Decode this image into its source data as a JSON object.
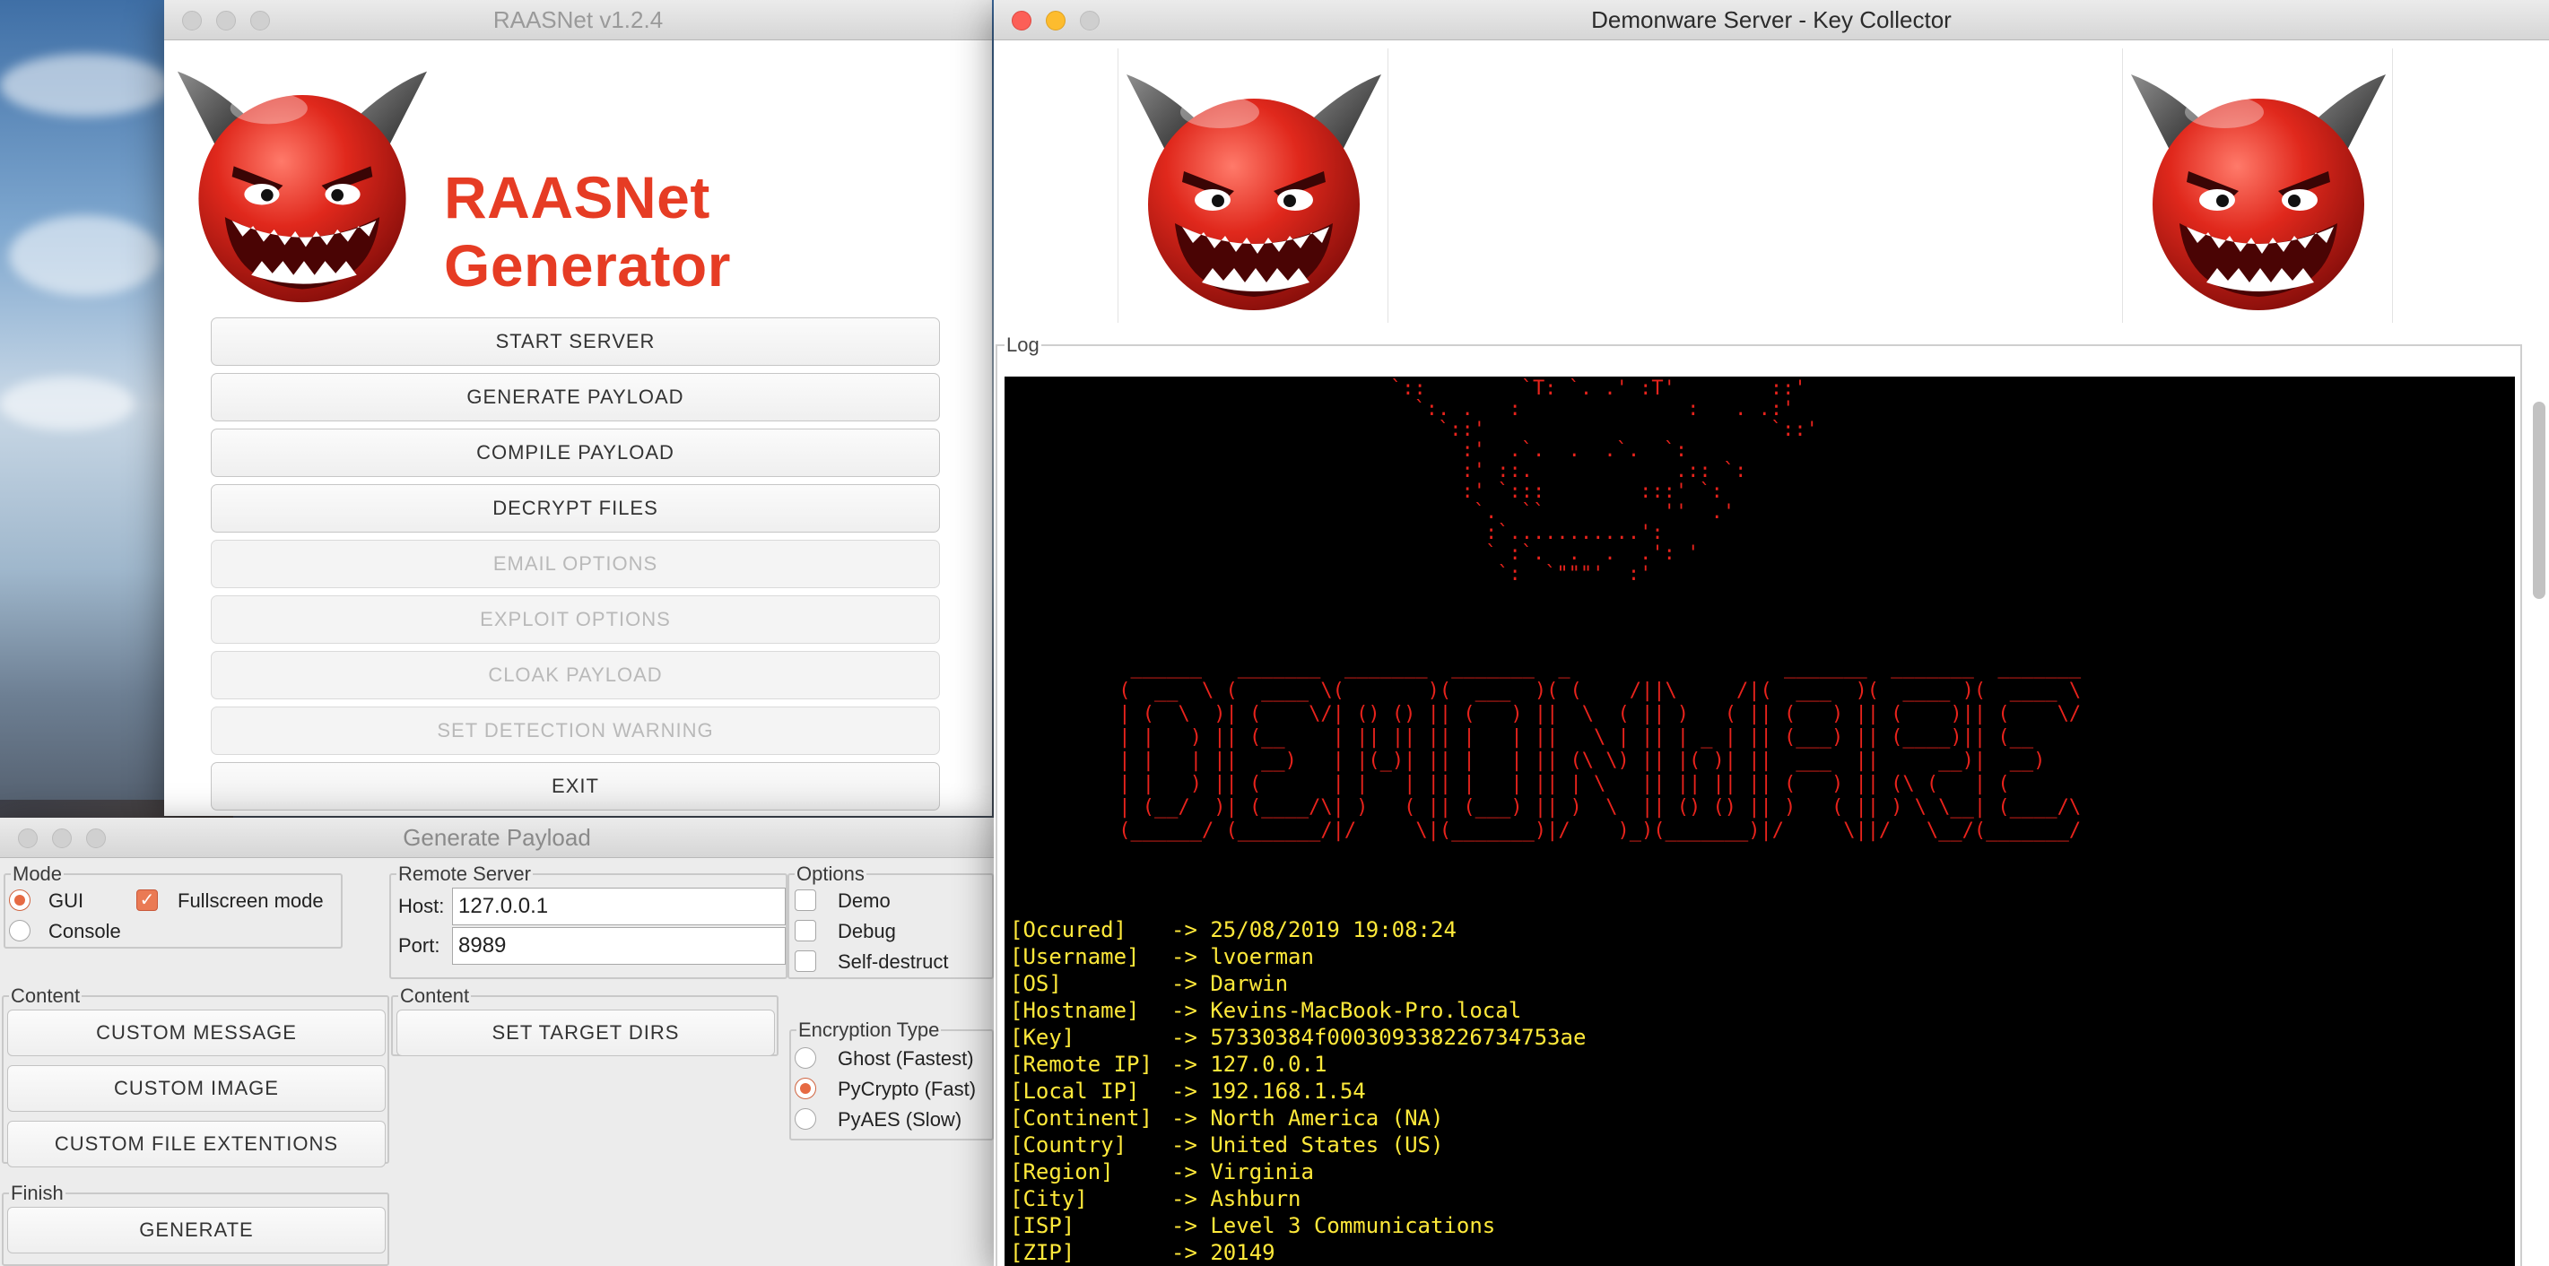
{
  "raasnet": {
    "window_title": "RAASNet v1.2.4",
    "heading": "RAASNet Generator",
    "buttons": [
      {
        "label": "START SERVER",
        "enabled": true
      },
      {
        "label": "GENERATE PAYLOAD",
        "enabled": true
      },
      {
        "label": "COMPILE PAYLOAD",
        "enabled": true
      },
      {
        "label": "DECRYPT FILES",
        "enabled": true
      },
      {
        "label": "EMAIL OPTIONS",
        "enabled": false
      },
      {
        "label": "EXPLOIT OPTIONS",
        "enabled": false
      },
      {
        "label": "CLOAK PAYLOAD",
        "enabled": false
      },
      {
        "label": "SET DETECTION WARNING",
        "enabled": false
      },
      {
        "label": "EXIT",
        "enabled": true
      }
    ]
  },
  "generate_payload": {
    "window_title": "Generate Payload",
    "mode": {
      "legend": "Mode",
      "gui_label": "GUI",
      "gui_selected": true,
      "console_label": "Console",
      "console_selected": false,
      "fullscreen_label": "Fullscreen mode",
      "fullscreen_checked": true
    },
    "remote_server": {
      "legend": "Remote Server",
      "host_label": "Host:",
      "host_value": "127.0.0.1",
      "port_label": "Port:",
      "port_value": "8989"
    },
    "options": {
      "legend": "Options",
      "demo_label": "Demo",
      "debug_label": "Debug",
      "self_destruct_label": "Self-destruct"
    },
    "content_left": {
      "legend": "Content",
      "custom_message": "CUSTOM MESSAGE",
      "custom_image": "CUSTOM IMAGE",
      "custom_file_ext": "CUSTOM FILE EXTENTIONS"
    },
    "content_right": {
      "legend": "Content",
      "set_target_dirs": "SET TARGET DIRS"
    },
    "encryption": {
      "legend": "Encryption Type",
      "ghost_label": "Ghost (Fastest)",
      "pycrypto_label": "PyCrypto (Fast)",
      "pyaes_label": "PyAES (Slow)",
      "selected": "PyCrypto (Fast)"
    },
    "finish": {
      "legend": "Finish",
      "generate": "GENERATE"
    }
  },
  "demonware": {
    "window_title": "Demonware Server - Key Collector",
    "log_legend": "Log",
    "ascii_skull": "`::        `T: `. .' :T'        ::'\n  `:. .   :              :   . .:'\n    `::'                        `::'\n      :'  .`.  .  .`.  `:\n      :' ::.            .:: `:\n      :' `:::        :::' `:\n       `.  ``          ''  .'\n        :`...........':\n        ` :`.  .  .  .': '\n         `:  `\"\"\"'  :'",
    "ascii_word": "  ______   _______  _______  _______  _                  _______  _______  _______\n (  __  \\ (  ____ \\(       )(  ___  )( (    /||\\     /|(  ___  )(  ____ )(  ____ \\\n | (  \\  )| (    \\/| () () || (   ) ||  \\  ( || )   ( || (   ) || (    )|| (    \\/\n | |   ) || (__    | || || || |   | ||   \\ | || | _ | || (___) || (____)|| (__\n | |   | ||  __)   | |(_)| || |   | || (\\ \\) || |( )| ||  ___  ||     __)|  __)\n | |   ) || (      | |   | || |   | || | \\   || || || || (   ) || (\\ (   | (\n | (__/  )| (____/\\| )   ( || (___) || )  \\  || () () || )   ( || ) \\ \\__| (____/\\\n (______/ (_______/|/     \\|(_______)|/    )_)(_______)|/     \\||/   \\__/(_______/",
    "info": [
      {
        "key": "[Occured]",
        "value": "25/08/2019 19:08:24"
      },
      {
        "key": "[Username]",
        "value": "lvoerman"
      },
      {
        "key": "[OS]",
        "value": "Darwin"
      },
      {
        "key": "[Hostname]",
        "value": "Kevins-MacBook-Pro.local"
      },
      {
        "key": "[Key]",
        "value": "57330384f000309338226734753ae"
      },
      {
        "key": "[Remote IP]",
        "value": "127.0.0.1"
      },
      {
        "key": "[Local IP]",
        "value": "192.168.1.54"
      },
      {
        "key": "[Continent]",
        "value": "North America (NA)"
      },
      {
        "key": "[Country]",
        "value": "United States (US)"
      },
      {
        "key": "[Region]",
        "value": "Virginia"
      },
      {
        "key": "[City]",
        "value": "Ashburn"
      },
      {
        "key": "[ISP]",
        "value": "Level 3 Communications"
      },
      {
        "key": "[ZIP]",
        "value": "20149"
      }
    ]
  },
  "colors": {
    "brand_red": "#e63c24",
    "console_bg": "#000000",
    "console_text": "#ffe93a",
    "ascii_red": "#e8231c",
    "accent_orange": "#e66a43"
  }
}
